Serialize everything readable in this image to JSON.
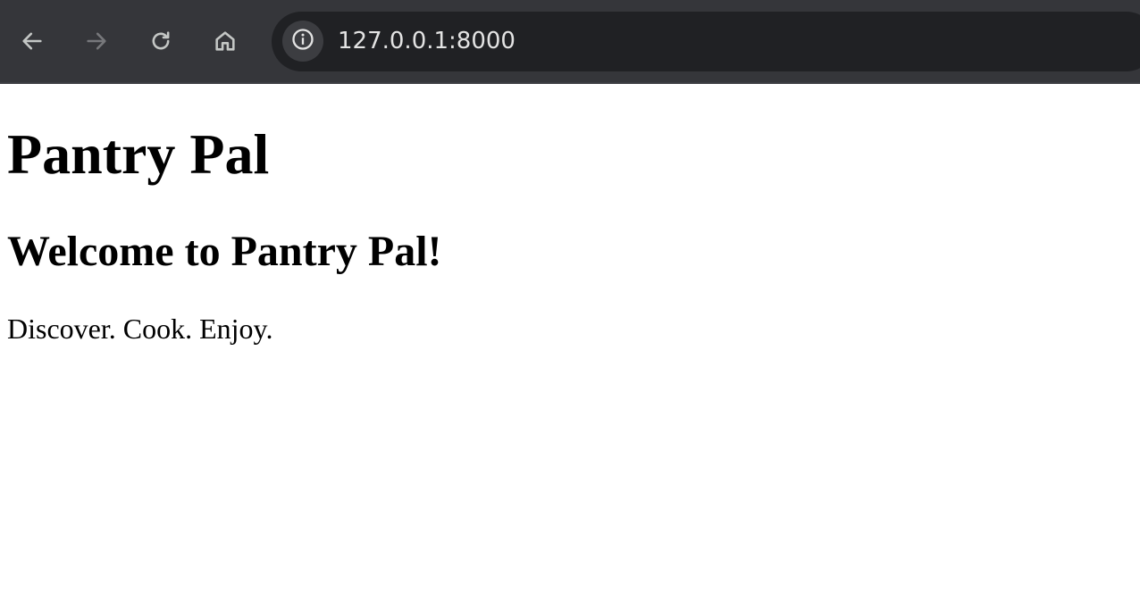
{
  "browser": {
    "url": "127.0.0.1:8000",
    "icons": {
      "back": "arrow-left-icon",
      "forward": "arrow-right-icon",
      "reload": "reload-icon",
      "home": "home-icon",
      "site_info": "info-icon"
    },
    "forward_enabled": false,
    "colors": {
      "toolbar": "#35363a",
      "omnibox": "#202124",
      "icon": "#c4c7c5",
      "icon_disabled": "#77787b"
    }
  },
  "page": {
    "title": "Pantry Pal",
    "heading": "Welcome to Pantry Pal!",
    "tagline": "Discover. Cook. Enjoy."
  }
}
